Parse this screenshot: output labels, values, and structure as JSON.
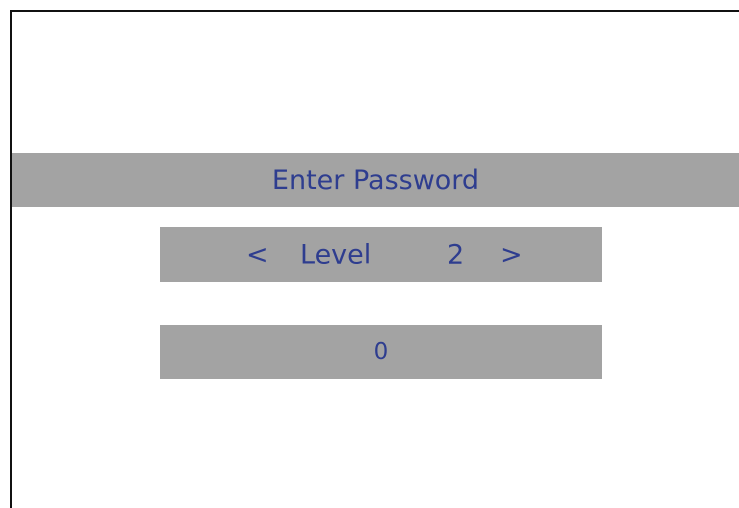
{
  "dialog": {
    "title": "Enter Password",
    "level": {
      "prev_label": "<",
      "label": "Level",
      "value": "2",
      "next_label": ">"
    },
    "password_value": "0"
  },
  "colors": {
    "panel": "#a3a3a3",
    "text": "#2e3d8f",
    "frame": "#111111",
    "background": "#ffffff"
  }
}
